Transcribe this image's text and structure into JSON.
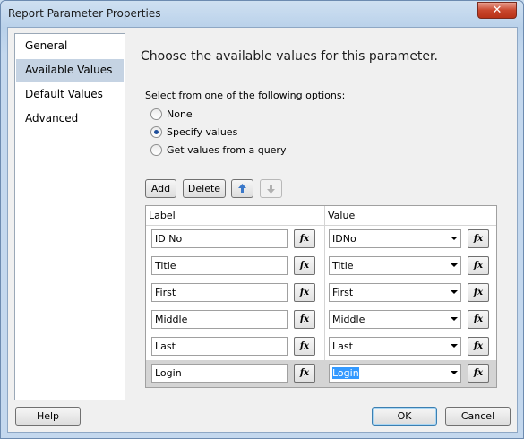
{
  "window": {
    "title": "Report Parameter Properties",
    "close_glyph": "✕"
  },
  "nav": {
    "items": [
      {
        "label": "General",
        "selected": false
      },
      {
        "label": "Available Values",
        "selected": true
      },
      {
        "label": "Default Values",
        "selected": false
      },
      {
        "label": "Advanced",
        "selected": false
      }
    ]
  },
  "main": {
    "heading": "Choose the available values for this parameter.",
    "options_label": "Select from one of the following options:",
    "options": [
      {
        "label": "None",
        "checked": false
      },
      {
        "label": "Specify values",
        "checked": true
      },
      {
        "label": "Get values from a query",
        "checked": false
      }
    ]
  },
  "toolbar": {
    "add_label": "Add",
    "delete_label": "Delete",
    "up_icon": "arrow-up-icon",
    "down_icon": "arrow-down-icon"
  },
  "grid": {
    "label_header": "Label",
    "value_header": "Value",
    "fx_label": "fx",
    "rows": [
      {
        "label": "ID No",
        "value": "IDNo"
      },
      {
        "label": "Title",
        "value": "Title"
      },
      {
        "label": "First",
        "value": "First"
      },
      {
        "label": "Middle",
        "value": "Middle"
      },
      {
        "label": "Last",
        "value": "Last"
      },
      {
        "label": "Login",
        "value": "Login"
      }
    ],
    "selected_row": 5
  },
  "footer": {
    "help_label": "Help",
    "ok_label": "OK",
    "cancel_label": "Cancel"
  },
  "colors": {
    "accent": "#3399ff",
    "selected_nav": "#c5d3e3",
    "close": "#c9462c"
  }
}
